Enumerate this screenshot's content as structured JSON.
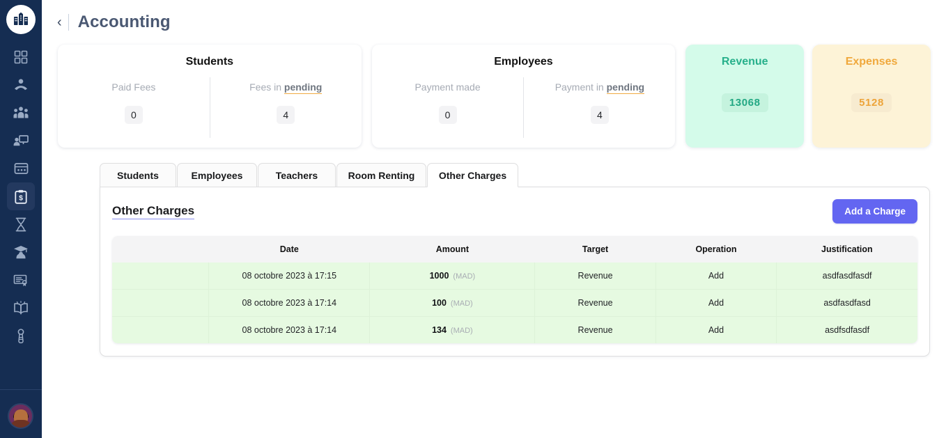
{
  "sidebar": {
    "logo": {
      "icon": "school-building-icon"
    },
    "items": [
      {
        "icon": "dashboard-grid-icon",
        "name": "dashboard",
        "active": false
      },
      {
        "icon": "student-reading-icon",
        "name": "students",
        "active": false
      },
      {
        "icon": "people-group-icon",
        "name": "employees",
        "active": false
      },
      {
        "icon": "teacher-presentation-icon",
        "name": "teachers",
        "active": false
      },
      {
        "icon": "classroom-window-icon",
        "name": "classrooms",
        "active": false
      },
      {
        "icon": "clipboard-dollar-icon",
        "name": "accounting",
        "active": true
      },
      {
        "icon": "hourglass-icon",
        "name": "timetable",
        "active": false
      },
      {
        "icon": "graduate-cap-icon",
        "name": "graduates",
        "active": false
      },
      {
        "icon": "certificate-icon",
        "name": "certificates",
        "active": false
      },
      {
        "icon": "open-book-icon",
        "name": "library",
        "active": false
      },
      {
        "icon": "keys-icon",
        "name": "access",
        "active": false
      }
    ],
    "avatar": {
      "icon": "user-avatar"
    }
  },
  "header": {
    "back_icon": "chevron-left-icon",
    "back_glyph": "‹",
    "title": "Accounting"
  },
  "stats": {
    "students": {
      "title": "Students",
      "left_label": "Paid Fees",
      "left_value": "0",
      "right_label_prefix": "Fees in ",
      "right_label_strong": "pending",
      "right_value": "4"
    },
    "employees": {
      "title": "Employees",
      "left_label": "Payment made",
      "left_value": "0",
      "right_label_prefix": "Payment in ",
      "right_label_strong": "pending",
      "right_value": "4"
    },
    "revenue": {
      "title": "Revenue",
      "value": "13068",
      "color": "#27b08b",
      "background": "#d4fbea"
    },
    "expenses": {
      "title": "Expenses",
      "value": "5128",
      "color": "#f0a83c",
      "background": "#fdf3d7"
    }
  },
  "tabs": [
    {
      "label": "Students",
      "active": false
    },
    {
      "label": "Employees",
      "active": false
    },
    {
      "label": "Teachers",
      "active": false
    },
    {
      "label": "Room Renting",
      "active": false
    },
    {
      "label": "Other Charges",
      "active": true
    }
  ],
  "panel": {
    "title": "Other Charges",
    "add_button": "Add a Charge",
    "accent_color": "#6366f1"
  },
  "table": {
    "columns": [
      "",
      "Date",
      "Amount",
      "Target",
      "Operation",
      "Justification"
    ],
    "rows": [
      {
        "date": "08 octobre 2023 à 17:15",
        "amount": "1000",
        "currency": "(MAD)",
        "target": "Revenue",
        "operation": "Add",
        "justification": "asdfasdfasdf"
      },
      {
        "date": "08 octobre 2023 à 17:14",
        "amount": "100",
        "currency": "(MAD)",
        "target": "Revenue",
        "operation": "Add",
        "justification": "asdfasdfasd"
      },
      {
        "date": "08 octobre 2023 à 17:14",
        "amount": "134",
        "currency": "(MAD)",
        "target": "Revenue",
        "operation": "Add",
        "justification": "asdfsdfasdf"
      }
    ]
  }
}
